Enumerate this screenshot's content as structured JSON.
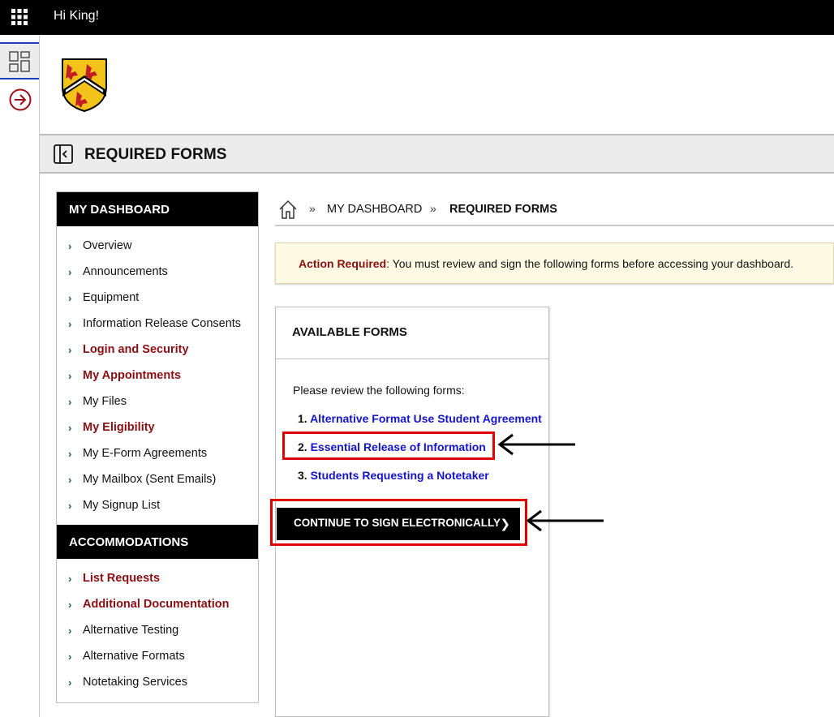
{
  "topbar": {
    "greeting": "Hi King!",
    "apps_icon": "grid-apps-icon"
  },
  "rail": {
    "dashboard_icon": "dashboard-icon",
    "logout_icon": "logout-arrow-icon"
  },
  "page": {
    "title": "REQUIRED FORMS"
  },
  "sidebar": {
    "sections": [
      {
        "heading": "MY DASHBOARD",
        "items": [
          {
            "label": "Overview",
            "highlight": false
          },
          {
            "label": "Announcements",
            "highlight": false
          },
          {
            "label": "Equipment",
            "highlight": false
          },
          {
            "label": "Information Release Consents",
            "highlight": false
          },
          {
            "label": "Login and Security",
            "highlight": true
          },
          {
            "label": "My Appointments",
            "highlight": true
          },
          {
            "label": "My Files",
            "highlight": false
          },
          {
            "label": "My Eligibility",
            "highlight": true
          },
          {
            "label": "My E-Form Agreements",
            "highlight": false
          },
          {
            "label": "My Mailbox (Sent Emails)",
            "highlight": false
          },
          {
            "label": "My Signup List",
            "highlight": false
          }
        ]
      },
      {
        "heading": "ACCOMMODATIONS",
        "items": [
          {
            "label": "List Requests",
            "highlight": true
          },
          {
            "label": "Additional Documentation",
            "highlight": true
          },
          {
            "label": "Alternative Testing",
            "highlight": false
          },
          {
            "label": "Alternative Formats",
            "highlight": false
          },
          {
            "label": "Notetaking Services",
            "highlight": false
          }
        ]
      }
    ]
  },
  "breadcrumb": {
    "home_icon": "home-icon",
    "items": [
      "MY DASHBOARD",
      "REQUIRED FORMS"
    ]
  },
  "alert": {
    "strong": "Action Required",
    "message": ": You must review and sign the following forms before accessing your dashboard."
  },
  "forms_card": {
    "heading": "AVAILABLE FORMS",
    "intro": "Please review the following forms:",
    "forms": [
      {
        "num": "1.",
        "label": "Alternative Format Use Student Agreement"
      },
      {
        "num": "2.",
        "label": "Essential Release of Information"
      },
      {
        "num": "3.",
        "label": "Students Requesting a Notetaker"
      }
    ],
    "continue_label": "CONTINUE TO SIGN ELECTRONICALLY"
  },
  "colors": {
    "accent_red": "#8b0f12",
    "link_blue": "#1414c8",
    "annotation_red": "#e00000"
  }
}
